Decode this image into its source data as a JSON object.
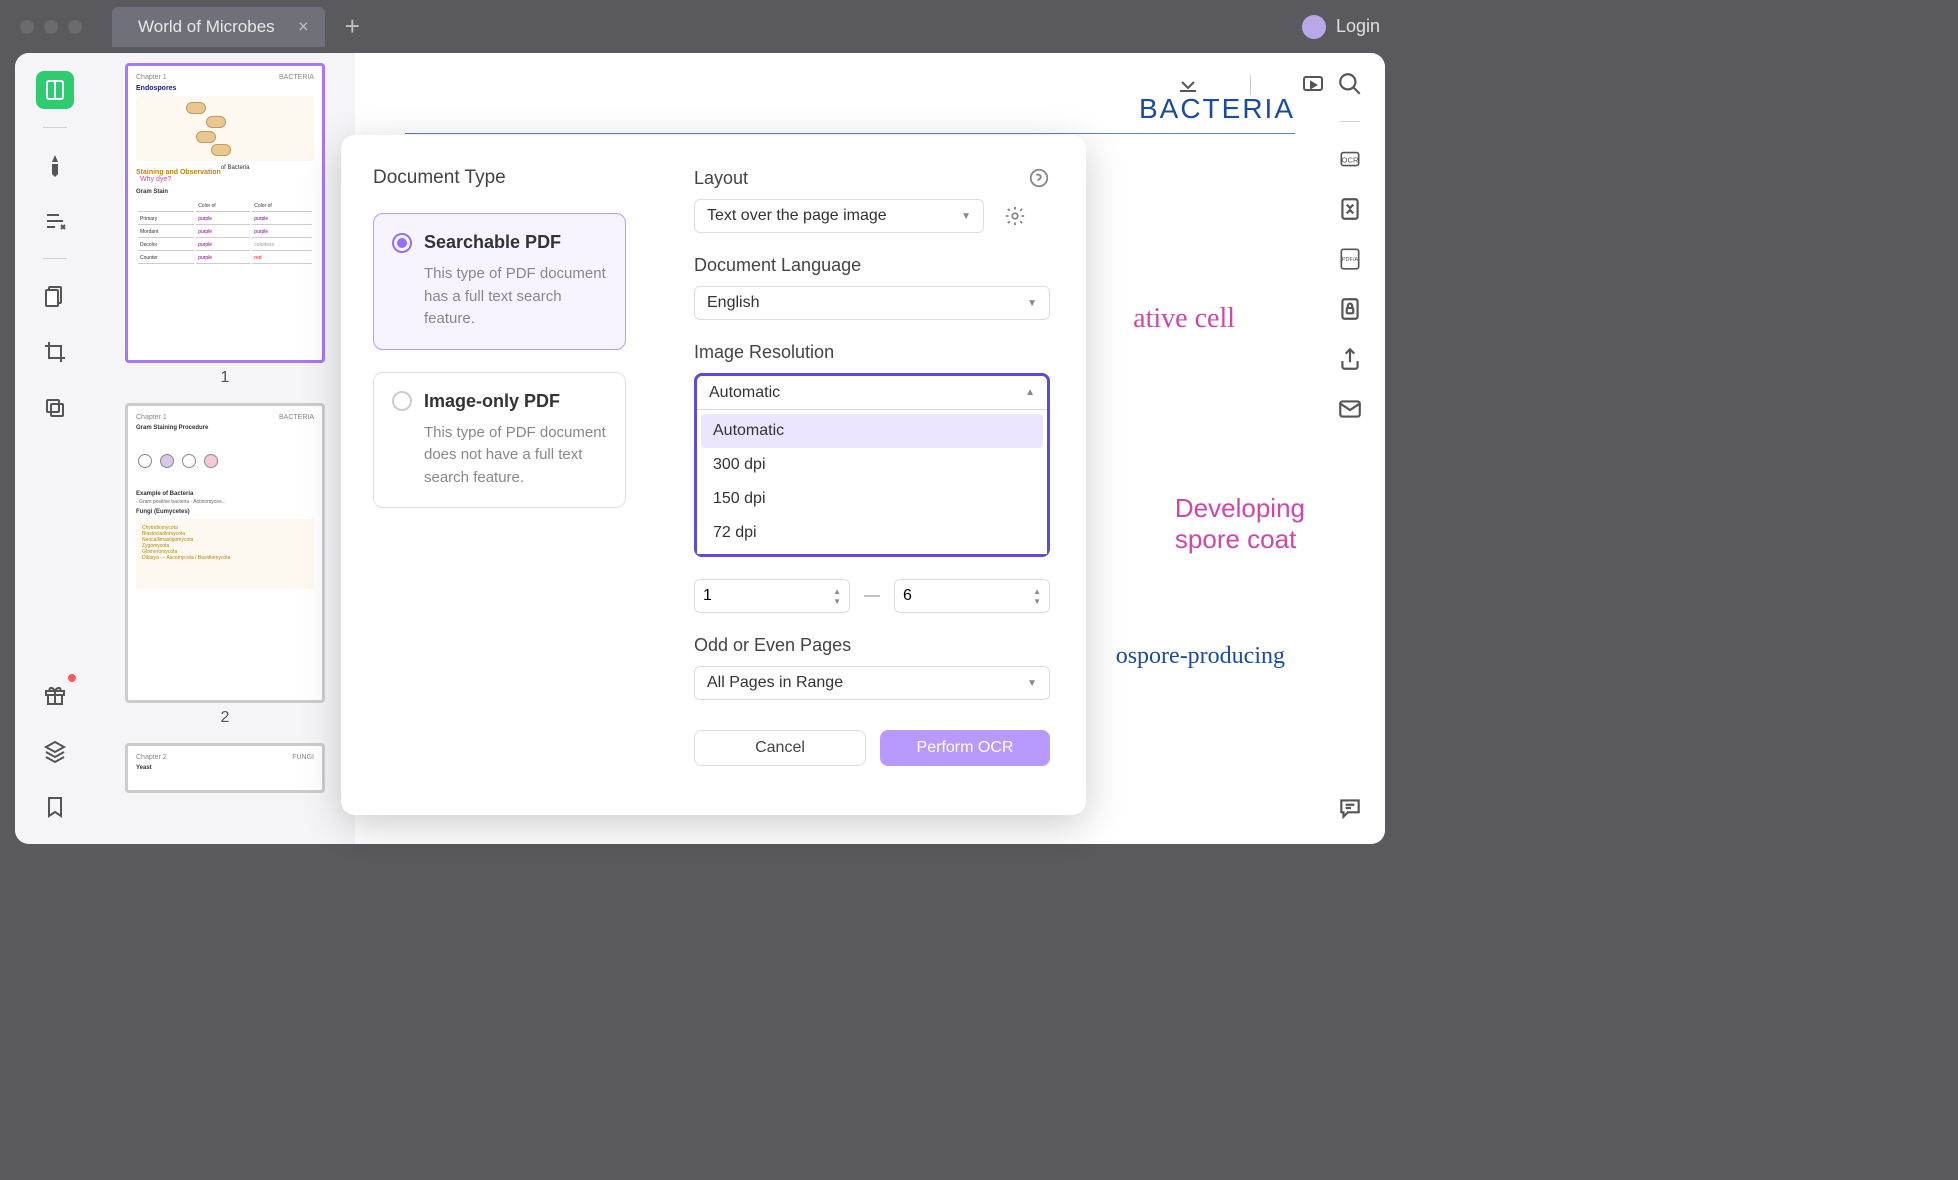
{
  "titlebar": {
    "tab_title": "World of Microbes",
    "login": "Login"
  },
  "thumbnails": {
    "page1_num": "1",
    "page2_num": "2",
    "chapter": "Chapter 1",
    "bacteria": "BACTERIA",
    "endospore": "Endospores",
    "staining": "Staining and Observation",
    "of_bacteria": " of Bacteria",
    "why_dye": "Why dye?",
    "gram_stain": "Gram Stain",
    "staining_proc": "Gram Staining Procedure",
    "example_bact": "Example of Bacteria",
    "fungi": "Fungi (Eumycetes)"
  },
  "document": {
    "bacteria": "BACTERIA",
    "vcell": "ative cell",
    "spore_coat_l1": "Developing",
    "spore_coat_l2": "spore coat",
    "producing": "ospore-producing",
    "staining": "Staining and Observation of Bacteria",
    "why_dye": "Why dye?"
  },
  "modal": {
    "doc_type_title": "Document Type",
    "searchable": {
      "label": "Searchable PDF",
      "desc": "This type of PDF document has a full text search feature."
    },
    "image_only": {
      "label": "Image-only PDF",
      "desc": "This type of PDF document does not have a full text search feature."
    },
    "layout_label": "Layout",
    "layout_value": "Text over the page image",
    "language_label": "Document Language",
    "language_value": "English",
    "resolution_label": "Image Resolution",
    "resolution_value": "Automatic",
    "resolution_options": [
      "Automatic",
      "300 dpi",
      "150 dpi",
      "72 dpi"
    ],
    "range_from": "1",
    "range_to": "6",
    "odd_even_label": "Odd or Even Pages",
    "odd_even_value": "All Pages in Range",
    "cancel": "Cancel",
    "perform": "Perform OCR"
  }
}
